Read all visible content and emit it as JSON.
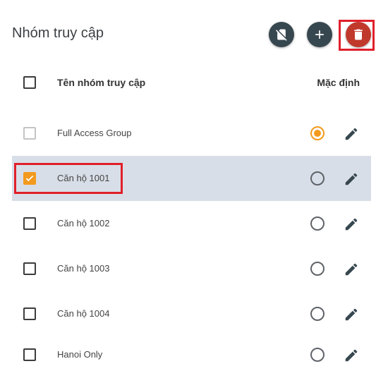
{
  "header": {
    "title": "Nhóm truy cập"
  },
  "toolbar": {
    "icons": [
      "no-sim-icon",
      "add-icon",
      "delete-icon"
    ],
    "colors": {
      "dark_fab": "#37474f",
      "delete_fab": "#c0392b",
      "highlight": "#e0202b"
    }
  },
  "table": {
    "columns": {
      "name": "Tên nhóm truy cập",
      "default": "Mặc định"
    },
    "accent": "#f39a1e",
    "rows": [
      {
        "name": "Full Access Group",
        "checked": false,
        "checkbox_disabled": true,
        "is_default": true
      },
      {
        "name": "Căn hộ 1001",
        "checked": true,
        "selected": true,
        "is_default": false
      },
      {
        "name": "Căn hộ 1002",
        "checked": false,
        "is_default": false
      },
      {
        "name": "Căn hộ 1003",
        "checked": false,
        "is_default": false
      },
      {
        "name": "Căn hộ 1004",
        "checked": false,
        "is_default": false
      },
      {
        "name": "Hanoi Only",
        "checked": false,
        "is_default": false
      }
    ]
  }
}
